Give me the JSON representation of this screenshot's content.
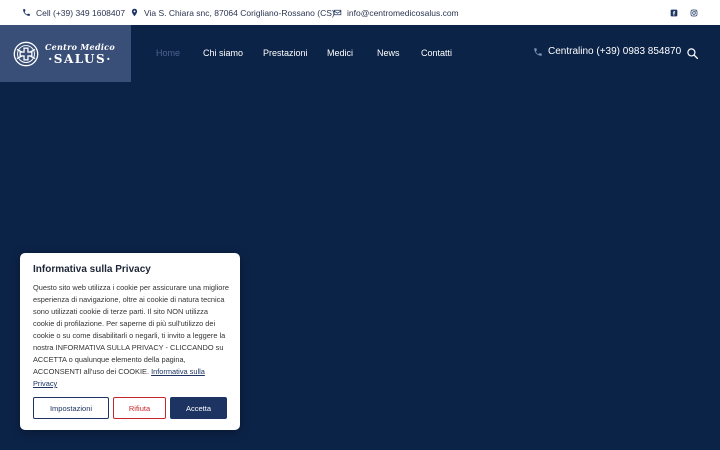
{
  "topbar": {
    "phone": "Cell (+39) 349 1608407",
    "address": "Via S. Chiara snc, 87064 Corigliano-Rossano (CS)",
    "email": "info@centromedicosalus.com",
    "social": [
      {
        "icon": "facebook-icon"
      },
      {
        "icon": "instagram-icon"
      }
    ]
  },
  "logo": {
    "line1": "Centro Medico",
    "line2": "·SALUS·"
  },
  "nav": {
    "items": [
      {
        "label": "Home",
        "active": true
      },
      {
        "label": "Chi siamo"
      },
      {
        "label": "Prestazioni"
      },
      {
        "label": "Medici"
      },
      {
        "label": "News"
      },
      {
        "label": "Contatti"
      }
    ]
  },
  "header": {
    "central_label": "Centralino (+39) 0983 854870"
  },
  "cookie": {
    "title": "Informativa sulla Privacy",
    "body": "Questo sito web utilizza i cookie per assicurare una migliore esperienza di navigazione, oltre ai cookie di natura tecnica sono utilizzati cookie di terze parti. Il sito NON utilizza cookie di profilazione. Per saperne di più sull'utilizzo dei cookie o su come disabilitarli o negarli, ti invito a leggere la nostra INFORMATIVA SULLA PRIVACY - CLICCANDO su ACCETTA o qualunque elemento della pagina, ACCONSENTI all'uso dei COOKIE.",
    "link": "Informativa sulla Privacy",
    "buttons": {
      "settings": "Impostazioni",
      "reject": "Rifiuta",
      "accept": "Accetta"
    }
  },
  "colors": {
    "navy": "#0c2348",
    "logo_bg": "#3a4f78",
    "accent": "#1d3462",
    "reject": "#c6272e"
  }
}
